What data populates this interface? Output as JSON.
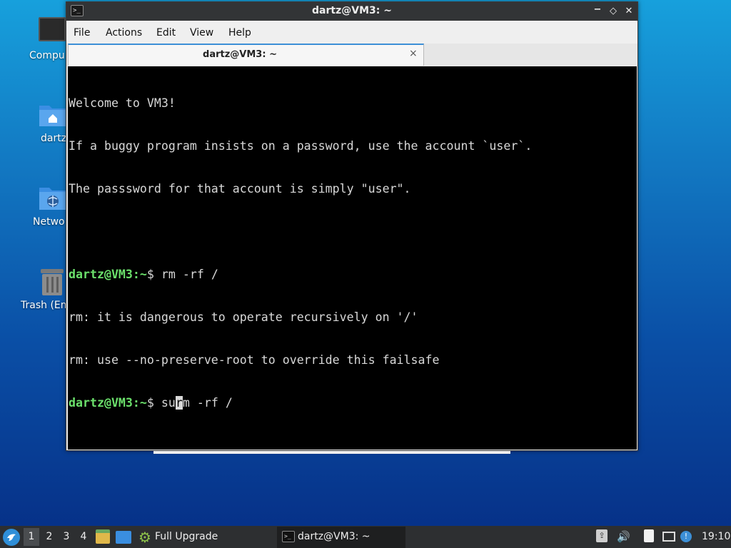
{
  "desktop": {
    "icons": [
      {
        "name": "computer",
        "label": "Compu"
      },
      {
        "name": "home-folder",
        "label": "dartz"
      },
      {
        "name": "network",
        "label": "Netwo"
      },
      {
        "name": "trash",
        "label": "Trash (Em"
      }
    ]
  },
  "window": {
    "title": "dartz@VM3: ~",
    "title_icon": ">_",
    "controls": {
      "minimize": "−",
      "maximize": "◇",
      "close": "✕"
    },
    "menu": [
      "File",
      "Actions",
      "Edit",
      "View",
      "Help"
    ],
    "tab": {
      "label": "dartz@VM3: ~",
      "close": "×"
    }
  },
  "terminal": {
    "lines": [
      "Welcome to VM3!",
      "If a buggy program insists on a password, use the account `user`.",
      "The passsword for that account is simply \"user\".",
      "",
      "rm: it is dangerous to operate recursively on '/'",
      "rm: use --no-preserve-root to override this failsafe"
    ],
    "prompt_user": "dartz@VM3",
    "prompt_path": ":~",
    "prompt_symbol": "$ ",
    "command_1": "rm -rf /",
    "command_2_before_cursor": "su",
    "command_2_cursor_char": "r",
    "command_2_after_cursor": "m -rf /"
  },
  "taskbar": {
    "start_icon": "start-menu-icon",
    "desktops": [
      "1",
      "2",
      "3",
      "4"
    ],
    "active_desktop": "1",
    "upgrade_label": "Full Upgrade",
    "task_terminal_label": "dartz@VM3: ~",
    "task_terminal_icon": ">_",
    "tray_upload": "⇪",
    "tray_volume": "🔊",
    "tray_update": "!",
    "clock": "19:10"
  },
  "colors": {
    "prompt_green": "#6be06b",
    "terminal_bg": "#000000",
    "titlebar": "#323436",
    "taskbar": "#2d2f31"
  }
}
